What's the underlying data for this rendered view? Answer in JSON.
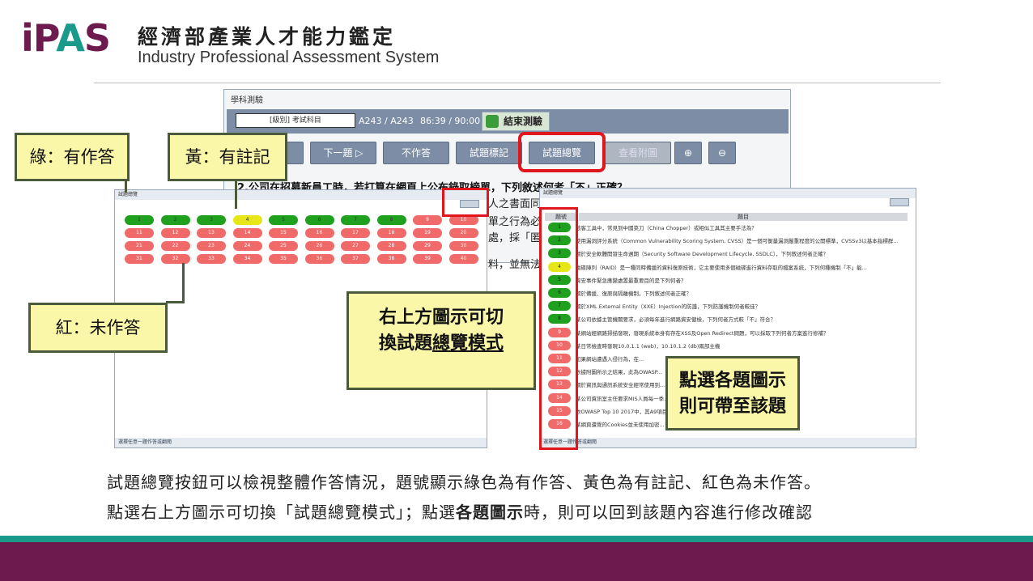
{
  "header": {
    "logo": {
      "part1": "iP",
      "part2": "A",
      "part3": "S"
    },
    "title_zh": "經濟部產業人才能力鑑定",
    "title_en": "Industry Professional Assessment System"
  },
  "exam_window": {
    "title": "學科測驗",
    "subject": "[級別] 考試科目",
    "question_count": "A243 / A243",
    "timer": "86:39 / 90:00",
    "end_exam": "結束測驗",
    "toolbar": {
      "next": "下一題",
      "skip": "不作答",
      "mark": "試題標記",
      "overview": "試題總覽",
      "attachment": "查看附圖"
    },
    "question": "2.公司在招募新員工時，若打算在網頁上公布錄取榜單，下列敘述何者「不」正確？",
    "visible_fragments": [
      "人之書面同",
      "單之行為必",
      "處，採「匿",
      "料，並無法"
    ]
  },
  "overview_left": {
    "title": "試題總覽",
    "footer": "選擇任意一題作答或翻閱",
    "rows": [
      [
        {
          "n": "1",
          "s": "g"
        },
        {
          "n": "2",
          "s": "g"
        },
        {
          "n": "3",
          "s": "g"
        },
        {
          "n": "4",
          "s": "y"
        },
        {
          "n": "5",
          "s": "g"
        },
        {
          "n": "6",
          "s": "g"
        },
        {
          "n": "7",
          "s": "g"
        },
        {
          "n": "8",
          "s": "g"
        },
        {
          "n": "9",
          "s": "r"
        },
        {
          "n": "10",
          "s": "r"
        }
      ],
      [
        {
          "n": "11",
          "s": "r"
        },
        {
          "n": "12",
          "s": "r"
        },
        {
          "n": "13",
          "s": "r"
        },
        {
          "n": "14",
          "s": "r"
        },
        {
          "n": "15",
          "s": "r"
        },
        {
          "n": "16",
          "s": "r"
        },
        {
          "n": "17",
          "s": "r"
        },
        {
          "n": "18",
          "s": "r"
        },
        {
          "n": "19",
          "s": "r"
        },
        {
          "n": "20",
          "s": "r"
        }
      ],
      [
        {
          "n": "21",
          "s": "r"
        },
        {
          "n": "22",
          "s": "r"
        },
        {
          "n": "23",
          "s": "r"
        },
        {
          "n": "24",
          "s": "r"
        },
        {
          "n": "25",
          "s": "r"
        },
        {
          "n": "26",
          "s": "r"
        },
        {
          "n": "27",
          "s": "r"
        },
        {
          "n": "28",
          "s": "r"
        },
        {
          "n": "29",
          "s": "r"
        },
        {
          "n": "30",
          "s": "r"
        }
      ],
      [
        {
          "n": "31",
          "s": "r"
        },
        {
          "n": "32",
          "s": "r"
        },
        {
          "n": "33",
          "s": "r"
        },
        {
          "n": "34",
          "s": "r"
        },
        {
          "n": "35",
          "s": "r"
        },
        {
          "n": "36",
          "s": "r"
        },
        {
          "n": "37",
          "s": "r"
        },
        {
          "n": "38",
          "s": "r"
        },
        {
          "n": "39",
          "s": "r"
        },
        {
          "n": "40",
          "s": "r"
        }
      ]
    ]
  },
  "overview_list": {
    "title": "試題總覽",
    "col_num": "題號",
    "col_q": "題目",
    "footer": "選擇任意一題作答或翻閱",
    "rows": [
      {
        "n": "1",
        "s": "g",
        "t": "駭客工具中，常見到中國菜刀（China Chopper）或相似工具其主要手法為？"
      },
      {
        "n": "2",
        "s": "g",
        "t": "使用漏洞評分系統（Common Vulnerability Scoring System, CVSS）是一個可衡量漏洞嚴重程度的公開標準，CVSSv3以基本指標群..."
      },
      {
        "n": "3",
        "s": "g",
        "t": "關於安全軟體開發生命週期（Security Software Development Lifecycle, SSDLC），下列敘述何者正確？"
      },
      {
        "n": "4",
        "s": "y",
        "t": "磁碟陣列（RAID）是一種同時備援的資料復原技術，它主要使用多個磁碟進行資料存取的檔案系統，下列何種機制「不」能..."
      },
      {
        "n": "5",
        "s": "g",
        "t": "資安事件緊急應變處置最重要目的是下列何者？"
      },
      {
        "n": "6",
        "s": "g",
        "t": "關於備援、復原與隔離機制，下列敘述何者正確？"
      },
      {
        "n": "7",
        "s": "g",
        "t": "關於XML External Entity（XXE）Injection的防護，下列防護機制何者較佳？"
      },
      {
        "n": "8",
        "s": "g",
        "t": "某公司依據主管機關要求，必須每年進行網路資安健檢，下列何者方式較「不」符合？"
      },
      {
        "n": "9",
        "s": "r",
        "t": "某網站經網路掃描發現，發現系統本身有存在XSS及Open Redirect問題，可以採取下列何者方案進行修補？"
      },
      {
        "n": "10",
        "s": "r",
        "t": "某日常檢查時發現10.0.1.1 (web)，10.10.1.2 (db)兩部主機"
      },
      {
        "n": "11",
        "s": "r",
        "t": "如果網站遭遇入侵行為，在..."
      },
      {
        "n": "12",
        "s": "r",
        "t": "依據附圖所示之結果，此為OWASP..."
      },
      {
        "n": "13",
        "s": "r",
        "t": "關於資訊與通訊系統安全經常使用到..."
      },
      {
        "n": "14",
        "s": "r",
        "t": "某公司資訊室主任要求MIS人員每一季...，基本項作業的目的？"
      },
      {
        "n": "15",
        "s": "r",
        "t": "依OWASP Top 10 2017中，其A9項目...，下列何種作法較佳？"
      },
      {
        "n": "16",
        "s": "r",
        "t": "某網頁遭覺的Cookies並未使用加密..."
      }
    ]
  },
  "callouts": {
    "green": "綠：有作答",
    "yellow": "黃：有註記",
    "red": "紅：未作答",
    "switch_line1": "右上方圖示可切",
    "switch_line2a": "換試題",
    "switch_line2b": "總覽模式",
    "jump_line1": "點選各題圖示",
    "jump_line2": "則可帶至該題"
  },
  "caption": {
    "line1": "試題總覽按鈕可以檢視整體作答情況，題號顯示綠色為有作答、黃色為有註記、紅色為未作答。",
    "line2_a": "點選右上方圖示可切換「試題總覽模式」；點選",
    "line2_b": "各題圖示",
    "line2_c": "時，則可以回到該題內容進行修改確認"
  },
  "colors": {
    "brand_purple": "#6d1b4f",
    "brand_teal": "#1a9a8a",
    "answered": "#1fa11f",
    "marked": "#e6e619",
    "unanswered": "#f06a6a",
    "highlight": "#e0161c"
  }
}
